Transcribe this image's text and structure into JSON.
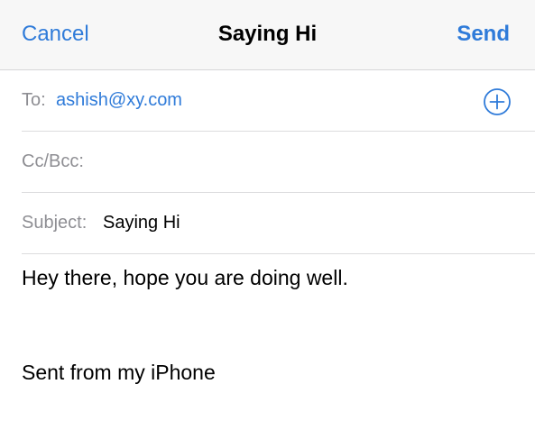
{
  "navbar": {
    "cancel_label": "Cancel",
    "title": "Saying Hi",
    "send_label": "Send"
  },
  "fields": {
    "to_label": "To:",
    "to_value": "ashish@xy.com",
    "add_contact_icon": "plus-circle-icon",
    "cc_label": "Cc/Bcc:",
    "cc_value": "",
    "subject_label": "Subject:",
    "subject_value": "Saying Hi"
  },
  "body": {
    "message": "Hey there, hope you are doing well.",
    "signature": "Sent from my iPhone"
  },
  "colors": {
    "accent": "#2f7bd9",
    "label_gray": "#8e8e93",
    "navbar_bg": "#f7f7f7",
    "separator": "#dcdcde"
  }
}
